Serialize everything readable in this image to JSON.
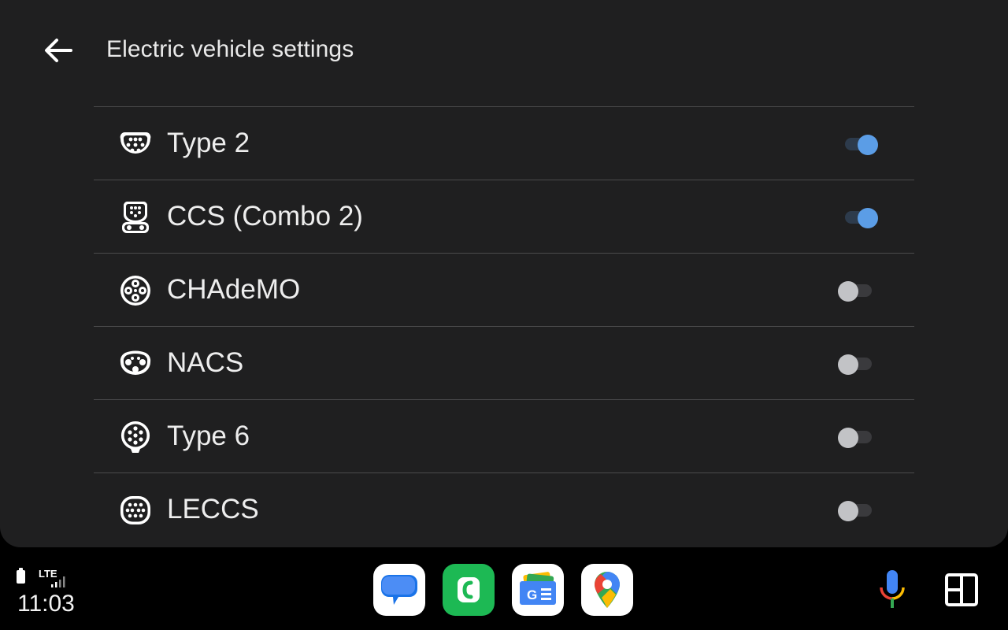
{
  "header": {
    "title": "Electric vehicle settings",
    "back_icon": "arrow-back-icon"
  },
  "connectors": [
    {
      "label": "Type 2",
      "icon": "type2-connector-icon",
      "enabled": true
    },
    {
      "label": "CCS (Combo 2)",
      "icon": "ccs-combo2-connector-icon",
      "enabled": true
    },
    {
      "label": "CHAdeMO",
      "icon": "chademo-connector-icon",
      "enabled": false
    },
    {
      "label": "NACS",
      "icon": "nacs-connector-icon",
      "enabled": false
    },
    {
      "label": "Type 6",
      "icon": "type6-connector-icon",
      "enabled": false
    },
    {
      "label": "LECCS",
      "icon": "leccs-connector-icon",
      "enabled": false
    }
  ],
  "colors": {
    "panel_bg": "#1f1f20",
    "toggle_on": "#5b9de6",
    "toggle_off": "#c2c3c6",
    "divider": "#4a4a4c"
  },
  "status": {
    "network": "LTE",
    "time": "11:03",
    "battery_icon": "battery-icon",
    "signal_icon": "signal-icon"
  },
  "dock": {
    "apps": [
      {
        "name": "Messages",
        "icon": "messages-app-icon"
      },
      {
        "name": "Phone",
        "icon": "phone-app-icon"
      },
      {
        "name": "Google News",
        "icon": "google-news-app-icon"
      },
      {
        "name": "Google Maps",
        "icon": "google-maps-app-icon"
      }
    ],
    "mic_icon": "microphone-icon",
    "layout_icon": "layout-grid-icon"
  }
}
